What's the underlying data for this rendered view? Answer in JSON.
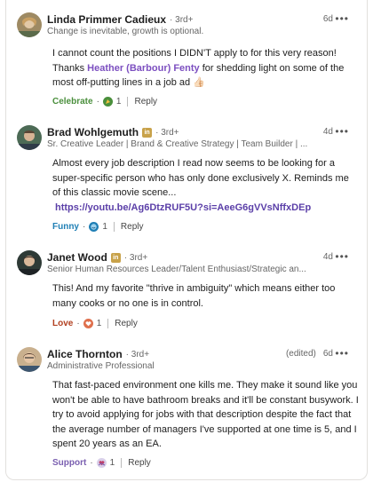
{
  "comments": [
    {
      "name": "Linda Primmer Cadieux",
      "degree": "· 3rd+",
      "headline": "Change is inevitable, growth is optional.",
      "time": "6d",
      "edited": "",
      "body_pre": "I cannot count the positions I DIDN'T apply to for this very reason! Thanks ",
      "mention": "Heather (Barbour) Fenty",
      "body_post": " for shedding light on some of the most off-putting lines in a job ad 👍🏻",
      "reaction_label": "Celebrate",
      "reaction_count": "1",
      "reply_label": "Reply",
      "reaction_color": "#4a8f3c",
      "badge": false
    },
    {
      "name": "Brad Wohlgemuth",
      "degree": "· 3rd+",
      "headline": "Sr. Creative Leader | Brand & Creative Strategy | Team Builder | ...",
      "time": "4d",
      "edited": "",
      "body_pre": "Almost every job description I read now seems to be looking for a super-specific person who has only done exclusively X. Reminds me of this classic movie scene...",
      "link": "https://youtu.be/Ag6DtzRUF5U?si=AeeG6gVVsNffxDEp",
      "reaction_label": "Funny",
      "reaction_count": "1",
      "reply_label": "Reply",
      "reaction_color": "#1f7fb5",
      "badge": true
    },
    {
      "name": "Janet Wood",
      "degree": "· 3rd+",
      "headline": "Senior Human Resources Leader/Talent Enthusiast/Strategic an...",
      "time": "4d",
      "edited": "",
      "body_pre": "This! And my favorite \"thrive in ambiguity\" which means either too many cooks or no one is in control.",
      "reaction_label": "Love",
      "reaction_count": "1",
      "reply_label": "Reply",
      "reaction_color": "#b24020",
      "badge": true
    },
    {
      "name": "Alice Thornton",
      "degree": "· 3rd+",
      "headline": "Administrative Professional",
      "time": "6d",
      "edited": "(edited)",
      "body_pre": "That fast-paced environment one kills me. They make it sound like you won't be able to have bathroom breaks and it'll be constant busywork. I try to avoid applying for jobs with that description despite the fact that the average number of managers I've supported at one time is 5, and I spent 20 years as an EA.",
      "reaction_label": "Support",
      "reaction_count": "1",
      "reply_label": "Reply",
      "reaction_color": "#7a5fb0",
      "badge": false
    }
  ],
  "icons": {
    "more": "more-options-icon",
    "celebrate": "celebrate-icon",
    "funny": "funny-icon",
    "love": "love-icon",
    "support": "support-icon",
    "linkedin_badge": "in"
  }
}
